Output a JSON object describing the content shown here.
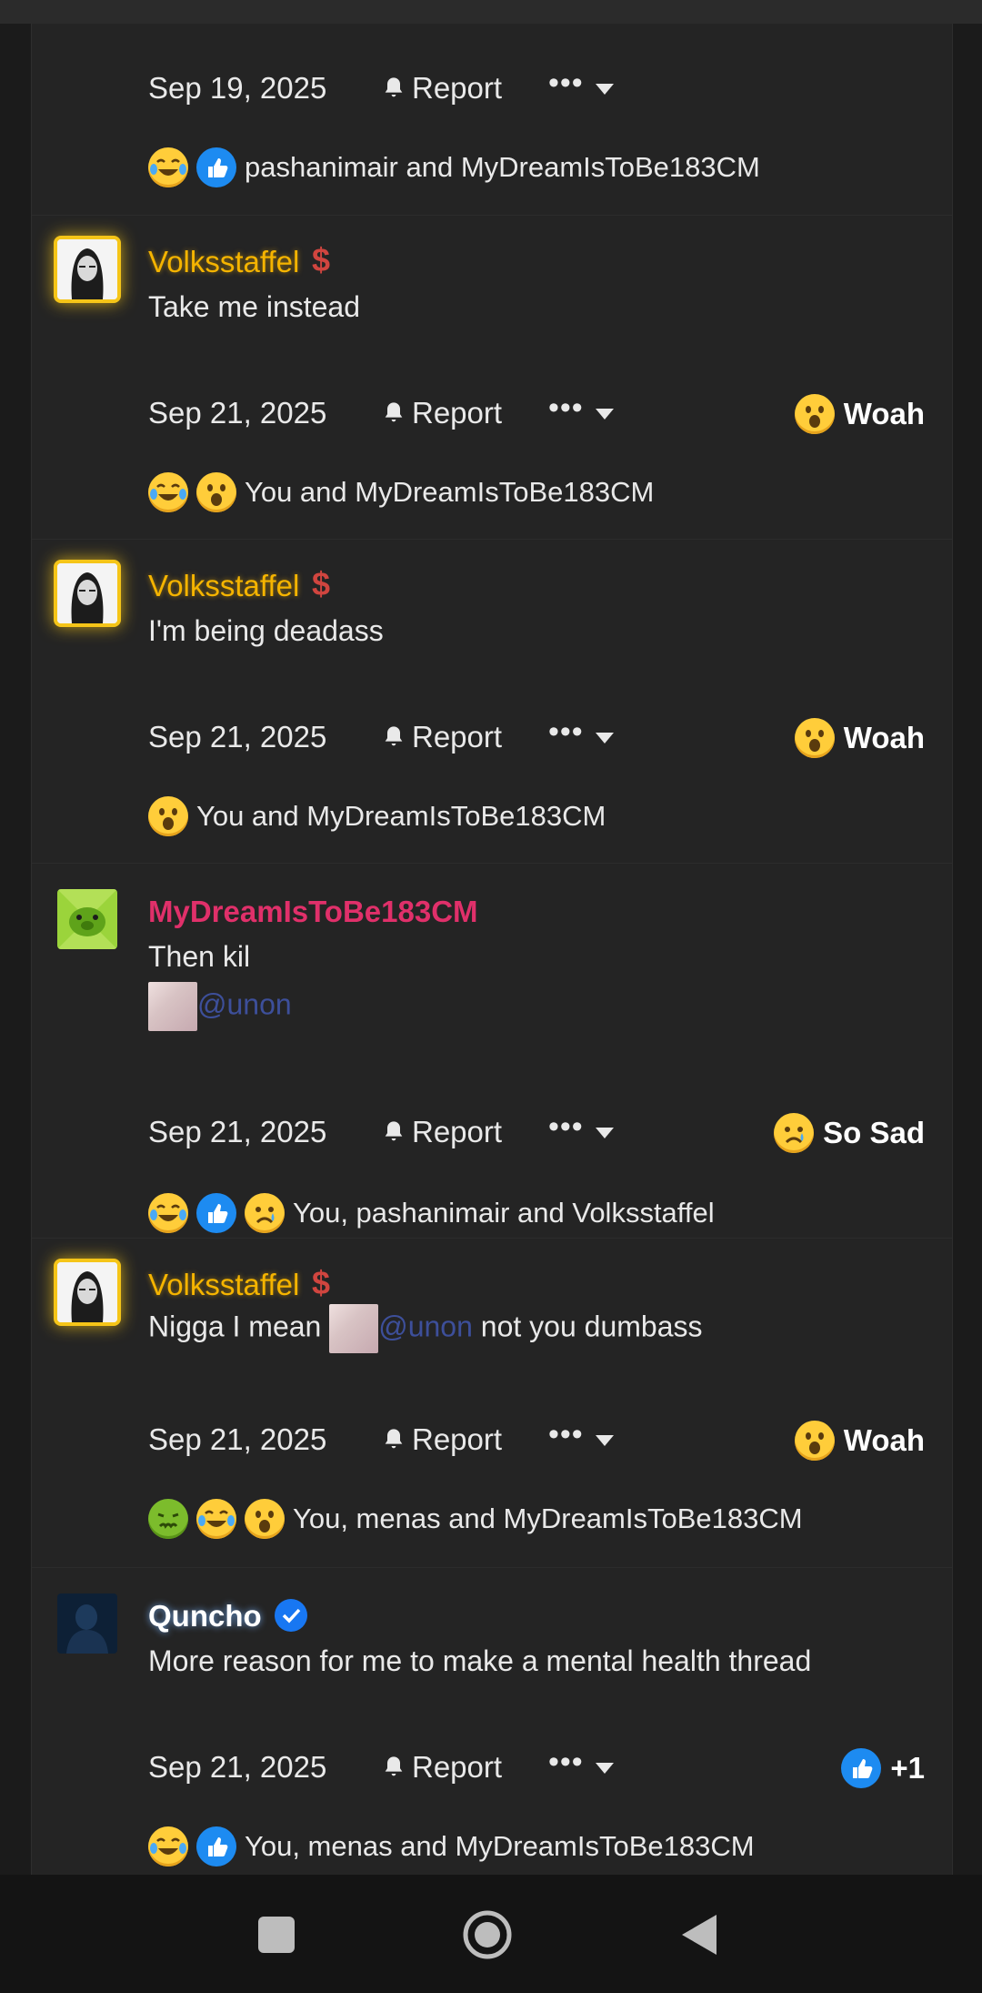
{
  "posts": [
    {
      "date": "Sep 19, 2025",
      "report": "Report",
      "reactors_text": "pashanimair and MyDreamIsToBe183CM",
      "reactor_icons": [
        "laughing-emoji-icon",
        "thumbs-up-icon"
      ]
    },
    {
      "username": "Volksstaffel",
      "badge": "$",
      "message": "Take me instead",
      "date": "Sep 21, 2025",
      "report": "Report",
      "reaction_label": "Woah",
      "reaction_icon": "wow-emoji-icon",
      "reactors_text": "You and MyDreamIsToBe183CM",
      "reactor_icons": [
        "laughing-emoji-icon",
        "wow-emoji-icon"
      ]
    },
    {
      "username": "Volksstaffel",
      "badge": "$",
      "message": "I'm being deadass",
      "date": "Sep 21, 2025",
      "report": "Report",
      "reaction_label": "Woah",
      "reaction_icon": "wow-emoji-icon",
      "reactors_text": "You and MyDreamIsToBe183CM",
      "reactor_icons": [
        "wow-emoji-icon"
      ]
    },
    {
      "username": "MyDreamIsToBe183CM",
      "message": "Then kil",
      "mention": "@unon",
      "date": "Sep 21, 2025",
      "report": "Report",
      "reaction_label": "So Sad",
      "reaction_icon": "sad-emoji-icon",
      "reactors_text": "You, pashanimair and Volksstaffel",
      "reactor_icons": [
        "laughing-emoji-icon",
        "thumbs-up-icon",
        "sad-emoji-icon"
      ]
    },
    {
      "username": "Volksstaffel",
      "badge": "$",
      "message_before": "Nigga I mean",
      "mention": "@unon",
      "message_after": "not you dumbass",
      "date": "Sep 21, 2025",
      "report": "Report",
      "reaction_label": "Woah",
      "reaction_icon": "wow-emoji-icon",
      "reactors_text": "You, menas and MyDreamIsToBe183CM",
      "reactor_icons": [
        "sick-emoji-icon",
        "laughing-emoji-icon",
        "wow-emoji-icon"
      ]
    },
    {
      "username": "Quncho",
      "message": "More reason for me to make a mental health thread",
      "date": "Sep 21, 2025",
      "report": "Report",
      "reaction_label": "+1",
      "reaction_icon": "thumbs-up-icon",
      "reactors_text": "You, menas and MyDreamIsToBe183CM",
      "reactor_icons": [
        "laughing-emoji-icon",
        "thumbs-up-icon"
      ]
    }
  ],
  "colors": {
    "background": "#1b1b1b",
    "thread_bg": "#242424",
    "gold_username": "#f5b400",
    "pink_username": "#e0306a",
    "mention": "#3d4f9a",
    "verified_blue": "#1877f2"
  },
  "navbar": {
    "icons": [
      "recent-apps-icon",
      "home-icon",
      "back-icon"
    ]
  }
}
